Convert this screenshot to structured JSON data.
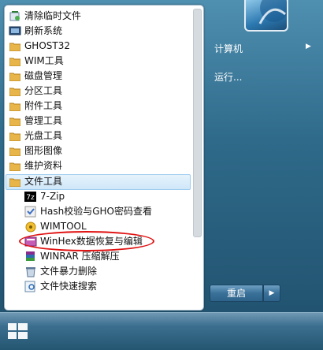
{
  "menu": {
    "items": [
      {
        "label": "清除临时文件",
        "kind": "special"
      },
      {
        "label": "刷新系统",
        "kind": "special"
      },
      {
        "label": "GHOST32",
        "kind": "folder"
      },
      {
        "label": "WIM工具",
        "kind": "folder"
      },
      {
        "label": "磁盘管理",
        "kind": "folder"
      },
      {
        "label": "分区工具",
        "kind": "folder"
      },
      {
        "label": "附件工具",
        "kind": "folder"
      },
      {
        "label": "管理工具",
        "kind": "folder"
      },
      {
        "label": "光盘工具",
        "kind": "folder"
      },
      {
        "label": "图形图像",
        "kind": "folder"
      },
      {
        "label": "维护资料",
        "kind": "folder"
      },
      {
        "label": "文件工具",
        "kind": "folder",
        "selected": true
      },
      {
        "label": "7-Zip",
        "kind": "sub"
      },
      {
        "label": "Hash校验与GHO密码查看",
        "kind": "sub"
      },
      {
        "label": "WIMTOOL",
        "kind": "sub"
      },
      {
        "label": "WinHex数据恢复与编辑",
        "kind": "sub",
        "annotated": true
      },
      {
        "label": "WINRAR 压缩解压",
        "kind": "sub"
      },
      {
        "label": "文件暴力删除",
        "kind": "sub"
      },
      {
        "label": "文件快速搜索",
        "kind": "sub"
      }
    ]
  },
  "right": {
    "computer": "计算机",
    "run": "运行...",
    "shutdown": "重启"
  },
  "colors": {
    "folder": "#e8b54a",
    "annotation": "#e01010",
    "selection": "#cfe7f9"
  }
}
